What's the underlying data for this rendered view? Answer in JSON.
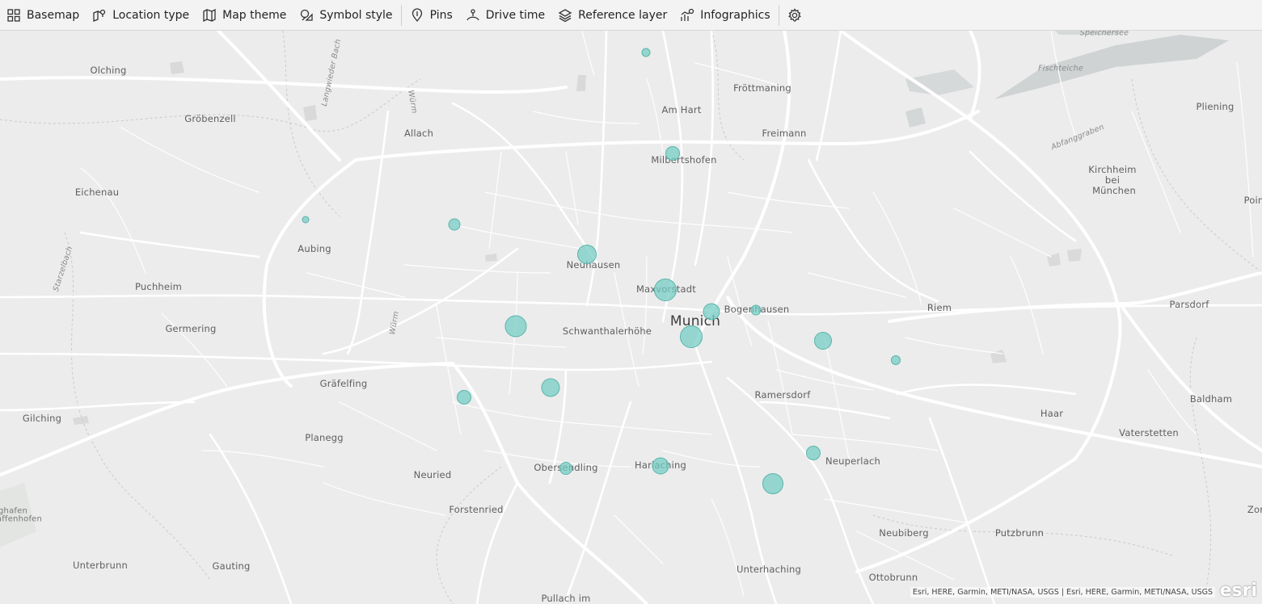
{
  "toolbar": {
    "items": [
      {
        "label": "Basemap",
        "icon": "basemap-icon"
      },
      {
        "label": "Location type",
        "icon": "location-type-icon"
      },
      {
        "label": "Map theme",
        "icon": "map-theme-icon"
      },
      {
        "label": "Symbol style",
        "icon": "symbol-style-icon"
      },
      {
        "label": "Pins",
        "icon": "pin-icon"
      },
      {
        "label": "Drive time",
        "icon": "drive-time-icon"
      },
      {
        "label": "Reference layer",
        "icon": "layers-icon"
      },
      {
        "label": "Infographics",
        "icon": "infographics-icon"
      }
    ],
    "settings_icon": "gear-icon"
  },
  "map": {
    "labels": [
      {
        "text": "Olching"
      },
      {
        "text": "Gröbenzell"
      },
      {
        "text": "Allach"
      },
      {
        "text": "Am Hart"
      },
      {
        "text": "Fröttmaning"
      },
      {
        "text": "Freimann"
      },
      {
        "text": "Milbertshofen"
      },
      {
        "text": "Eichenau"
      },
      {
        "text": "Aubing"
      },
      {
        "text": "Neuhausen"
      },
      {
        "text": "Puchheim"
      },
      {
        "text": "Maxvorstadt"
      },
      {
        "text": "Bogenhausen"
      },
      {
        "text": "Munich"
      },
      {
        "text": "Germering"
      },
      {
        "text": "Schwanthalerhöhe"
      },
      {
        "text": "Riem"
      },
      {
        "text": "Parsdorf"
      },
      {
        "text": "Gräfelfing"
      },
      {
        "text": "Ramersdorf"
      },
      {
        "text": "Gilching"
      },
      {
        "text": "Planegg"
      },
      {
        "text": "Baldham"
      },
      {
        "text": "Haar"
      },
      {
        "text": "Vaterstetten"
      },
      {
        "text": "Neuried"
      },
      {
        "text": "Obersendling"
      },
      {
        "text": "Harlaching"
      },
      {
        "text": "Neuperlach"
      },
      {
        "text": "Forstenried"
      },
      {
        "text": "Neubiberg"
      },
      {
        "text": "Putzbrunn"
      },
      {
        "text": "Unterbrunn"
      },
      {
        "text": "Gauting"
      },
      {
        "text": "Unterhaching"
      },
      {
        "text": "Ottobrunn"
      },
      {
        "text": "Pullach im"
      },
      {
        "text": "Kirchheim"
      },
      {
        "text": "bei"
      },
      {
        "text": "München"
      },
      {
        "text": "Pliening"
      },
      {
        "text": "Poin"
      },
      {
        "text": "Zor"
      },
      {
        "text": "ghafen"
      },
      {
        "text": "affenhofen"
      }
    ],
    "water_labels": [
      {
        "text": "Speichersee"
      },
      {
        "text": "Fischteiche"
      },
      {
        "text": "Abfanggraben"
      },
      {
        "text": "Starzelbach"
      },
      {
        "text": "Würm"
      },
      {
        "text": "Würm"
      },
      {
        "text": "Langwieder Bach"
      }
    ],
    "attribution": "Esri, HERE, Garmin, METI/NASA, USGS | Esri, HERE, Garmin, METI/NASA, USGS",
    "logo": "esri",
    "bubble_color": "#71cdc3"
  }
}
